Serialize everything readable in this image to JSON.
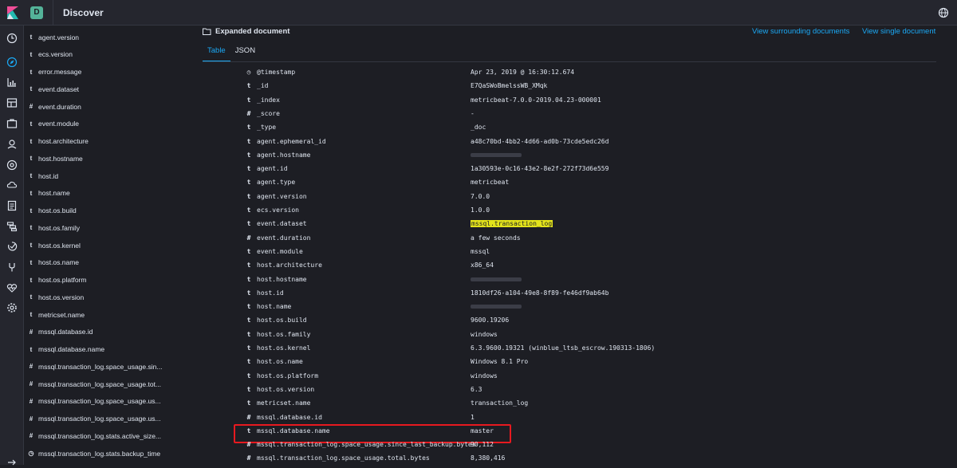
{
  "header": {
    "space_initial": "D",
    "app_title": "Discover"
  },
  "navrail": {
    "icons": [
      "clock-icon",
      "compass-icon",
      "visualize-icon",
      "dashboard-icon",
      "canvas-icon",
      "maps-icon",
      "ml-icon",
      "infrastructure-icon",
      "logs-icon",
      "apm-icon",
      "uptime-icon",
      "dev-tools-icon",
      "monitoring-icon",
      "management-icon"
    ]
  },
  "sidebar": {
    "fields": [
      {
        "type": "t",
        "name": "agent.version"
      },
      {
        "type": "t",
        "name": "ecs.version"
      },
      {
        "type": "t",
        "name": "error.message"
      },
      {
        "type": "t",
        "name": "event.dataset"
      },
      {
        "type": "#",
        "name": "event.duration"
      },
      {
        "type": "t",
        "name": "event.module"
      },
      {
        "type": "t",
        "name": "host.architecture"
      },
      {
        "type": "t",
        "name": "host.hostname"
      },
      {
        "type": "t",
        "name": "host.id"
      },
      {
        "type": "t",
        "name": "host.name"
      },
      {
        "type": "t",
        "name": "host.os.build"
      },
      {
        "type": "t",
        "name": "host.os.family"
      },
      {
        "type": "t",
        "name": "host.os.kernel"
      },
      {
        "type": "t",
        "name": "host.os.name"
      },
      {
        "type": "t",
        "name": "host.os.platform"
      },
      {
        "type": "t",
        "name": "host.os.version"
      },
      {
        "type": "t",
        "name": "metricset.name"
      },
      {
        "type": "#",
        "name": "mssql.database.id"
      },
      {
        "type": "t",
        "name": "mssql.database.name"
      },
      {
        "type": "#",
        "name": "mssql.transaction_log.space_usage.sin..."
      },
      {
        "type": "#",
        "name": "mssql.transaction_log.space_usage.tot..."
      },
      {
        "type": "#",
        "name": "mssql.transaction_log.space_usage.us..."
      },
      {
        "type": "#",
        "name": "mssql.transaction_log.space_usage.us..."
      },
      {
        "type": "#",
        "name": "mssql.transaction_log.stats.active_size..."
      },
      {
        "type": "◷",
        "name": "mssql.transaction_log.stats.backup_time"
      }
    ]
  },
  "document": {
    "title": "Expanded document",
    "links": {
      "surrounding": "View surrounding documents",
      "single": "View single document"
    },
    "tabs": [
      {
        "label": "Table",
        "active": true
      },
      {
        "label": "JSON",
        "active": false
      }
    ],
    "rows": [
      {
        "type": "◷",
        "field": "@timestamp",
        "value": "Apr 23, 2019 @ 16:30:12.674"
      },
      {
        "type": "t",
        "field": "_id",
        "value": "E7QaSWoBmelssWB_XMqk"
      },
      {
        "type": "t",
        "field": "_index",
        "value": "metricbeat-7.0.0-2019.04.23-000001"
      },
      {
        "type": "#",
        "field": "_score",
        "value": " -"
      },
      {
        "type": "t",
        "field": "_type",
        "value": "_doc"
      },
      {
        "type": "t",
        "field": "agent.ephemeral_id",
        "value": "a48c70bd-4bb2-4d66-ad0b-73cde5edc26d"
      },
      {
        "type": "t",
        "field": "agent.hostname",
        "value": ""
      },
      {
        "type": "t",
        "field": "agent.id",
        "value": "1a30593e-0c16-43e2-8e2f-272f73d6e559"
      },
      {
        "type": "t",
        "field": "agent.type",
        "value": "metricbeat"
      },
      {
        "type": "t",
        "field": "agent.version",
        "value": "7.0.0"
      },
      {
        "type": "t",
        "field": "ecs.version",
        "value": "1.0.0"
      },
      {
        "type": "t",
        "field": "event.dataset",
        "value": "mssql.transaction_log"
      },
      {
        "type": "#",
        "field": "event.duration",
        "value": "a few seconds"
      },
      {
        "type": "t",
        "field": "event.module",
        "value": "mssql"
      },
      {
        "type": "t",
        "field": "host.architecture",
        "value": "x86_64"
      },
      {
        "type": "t",
        "field": "host.hostname",
        "value": ""
      },
      {
        "type": "t",
        "field": "host.id",
        "value": "1810df26-a104-49e8-8f89-fe46df9ab64b"
      },
      {
        "type": "t",
        "field": "host.name",
        "value": ""
      },
      {
        "type": "t",
        "field": "host.os.build",
        "value": "9600.19206"
      },
      {
        "type": "t",
        "field": "host.os.family",
        "value": "windows"
      },
      {
        "type": "t",
        "field": "host.os.kernel",
        "value": "6.3.9600.19321 (winblue_ltsb_escrow.190313-1806)"
      },
      {
        "type": "t",
        "field": "host.os.name",
        "value": "Windows 8.1 Pro"
      },
      {
        "type": "t",
        "field": "host.os.platform",
        "value": "windows"
      },
      {
        "type": "t",
        "field": "host.os.version",
        "value": "6.3"
      },
      {
        "type": "t",
        "field": "metricset.name",
        "value": "transaction_log"
      },
      {
        "type": "#",
        "field": "mssql.database.id",
        "value": "1"
      },
      {
        "type": "t",
        "field": "mssql.database.name",
        "value": "master"
      },
      {
        "type": "#",
        "field": "mssql.transaction_log.space_usage.since_last_backup.bytes",
        "value": "90,112"
      },
      {
        "type": "#",
        "field": "mssql.transaction_log.space_usage.total.bytes",
        "value": "8,380,416"
      }
    ]
  },
  "colors": {
    "accent": "#1ba9f5",
    "highlight": "#e3e31b",
    "annotation_box": "#e7191f"
  }
}
